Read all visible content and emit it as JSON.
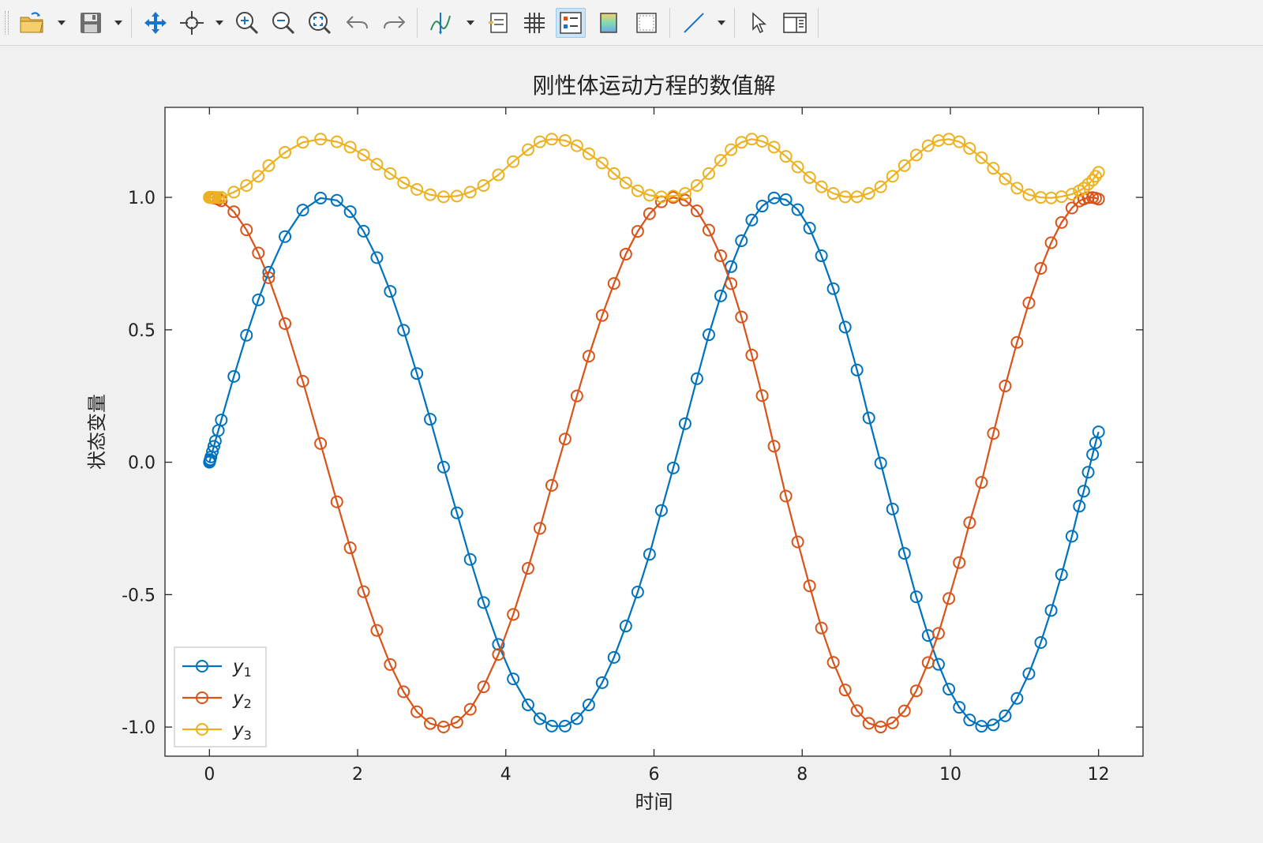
{
  "toolbar": {
    "buttons": [
      {
        "name": "open-file-icon",
        "dropdown": true
      },
      {
        "name": "save-icon",
        "dropdown": true
      },
      {
        "name": "pan-icon",
        "dropdown": false
      },
      {
        "name": "rotate-3d-icon",
        "dropdown": true
      },
      {
        "name": "zoom-in-icon",
        "dropdown": false
      },
      {
        "name": "zoom-out-icon",
        "dropdown": false
      },
      {
        "name": "zoom-fit-icon",
        "dropdown": false
      },
      {
        "name": "undo-icon",
        "dropdown": false
      },
      {
        "name": "redo-icon",
        "dropdown": false
      },
      {
        "name": "data-cursor-icon",
        "dropdown": true
      },
      {
        "name": "insert-legend-icon",
        "dropdown": false
      },
      {
        "name": "grid-icon",
        "dropdown": false
      },
      {
        "name": "legend-toggle-icon",
        "dropdown": false,
        "active": true
      },
      {
        "name": "colorbar-icon",
        "dropdown": false
      },
      {
        "name": "axes-box-icon",
        "dropdown": false
      },
      {
        "name": "insert-line-icon",
        "dropdown": true
      },
      {
        "name": "select-pointer-icon",
        "dropdown": false
      },
      {
        "name": "property-editor-icon",
        "dropdown": false
      }
    ],
    "accent": "#1a73c9"
  },
  "chart_data": {
    "type": "line",
    "title": "刚性体运动方程的数值解",
    "xlabel": "时间",
    "ylabel": "状态变量",
    "xlim": [
      -0.6,
      12.6
    ],
    "ylim": [
      -1.11,
      1.34
    ],
    "xticks": [
      0,
      2,
      4,
      6,
      8,
      10,
      12
    ],
    "xtick_labels": [
      "0",
      "2",
      "4",
      "6",
      "8",
      "10",
      "12"
    ],
    "yticks": [
      -1.0,
      -0.5,
      0.0,
      0.5,
      1.0
    ],
    "ytick_labels": [
      "-1.0",
      "-0.5",
      "0.0",
      "0.5",
      "1.0"
    ],
    "grid": false,
    "legend_position": "bottom-left",
    "marker": "circle",
    "x": [
      0,
      0.005,
      0.01,
      0.02,
      0.04,
      0.06,
      0.08,
      0.12,
      0.16,
      0.33,
      0.5,
      0.66,
      0.8,
      1.02,
      1.26,
      1.5,
      1.72,
      1.9,
      2.08,
      2.26,
      2.44,
      2.62,
      2.8,
      2.98,
      3.16,
      3.34,
      3.52,
      3.7,
      3.9,
      4.1,
      4.3,
      4.46,
      4.62,
      4.8,
      4.96,
      5.12,
      5.3,
      5.46,
      5.62,
      5.78,
      5.94,
      6.1,
      6.26,
      6.42,
      6.58,
      6.74,
      6.9,
      7.04,
      7.18,
      7.32,
      7.46,
      7.62,
      7.78,
      7.94,
      8.1,
      8.26,
      8.42,
      8.58,
      8.74,
      8.9,
      9.06,
      9.22,
      9.38,
      9.54,
      9.7,
      9.84,
      9.98,
      10.12,
      10.26,
      10.42,
      10.58,
      10.74,
      10.9,
      11.06,
      11.22,
      11.36,
      11.5,
      11.64,
      11.74,
      11.8,
      11.86,
      11.92,
      11.96,
      12.0
    ],
    "series": [
      {
        "name": "y",
        "sub": "1",
        "color": "#0072bd",
        "values": [
          0,
          0.005,
          0.01,
          0.02,
          0.04,
          0.06,
          0.08,
          0.1198,
          0.1593,
          0.3241,
          0.4794,
          0.6131,
          0.7174,
          0.8521,
          0.9521,
          0.9975,
          0.9889,
          0.9463,
          0.8724,
          0.7725,
          0.6453,
          0.4984,
          0.335,
          0.1622,
          -0.0184,
          -0.1912,
          -0.3671,
          -0.5298,
          -0.6878,
          -0.8182,
          -0.9162,
          -0.9683,
          -0.9962,
          -0.9962,
          -0.9682,
          -0.9164,
          -0.8323,
          -0.7369,
          -0.6187,
          -0.4901,
          -0.3477,
          -0.1822,
          -0.0216,
          0.1456,
          0.3155,
          0.4815,
          0.6282,
          0.7385,
          0.8362,
          0.9146,
          0.9673,
          0.9981,
          0.9915,
          0.9537,
          0.8839,
          0.7795,
          0.6554,
          0.5102,
          0.3481,
          0.1673,
          -0.0032,
          -0.1767,
          -0.3442,
          -0.5082,
          -0.6543,
          -0.7633,
          -0.8571,
          -0.9255,
          -0.9734,
          -0.9971,
          -0.9917,
          -0.9575,
          -0.8916,
          -0.7985,
          -0.6809,
          -0.5596,
          -0.4245,
          -0.2796,
          -0.1661,
          -0.1094,
          -0.0377,
          0.0294,
          0.0733,
          0.1146
        ]
      },
      {
        "name": "y",
        "sub": "2",
        "color": "#d95319",
        "values": [
          1.0,
          1.0,
          1.0,
          0.9998,
          0.9992,
          0.9982,
          0.9968,
          0.9928,
          0.9872,
          0.946,
          0.8776,
          0.79,
          0.6967,
          0.5234,
          0.3058,
          0.0707,
          -0.1494,
          -0.3233,
          -0.4889,
          -0.6351,
          -0.7638,
          -0.8668,
          -0.9422,
          -0.9868,
          -0.9998,
          -0.9816,
          -0.933,
          -0.848,
          -0.7259,
          -0.5748,
          -0.4008,
          -0.2497,
          -0.0873,
          0.0875,
          0.2502,
          0.4004,
          0.5541,
          0.6749,
          0.7858,
          0.8718,
          0.9383,
          0.9834,
          0.9998,
          0.9894,
          0.9491,
          0.8765,
          0.7797,
          0.6743,
          0.5484,
          0.4045,
          0.2515,
          0.0606,
          -0.1279,
          -0.3007,
          -0.4668,
          -0.6262,
          -0.7558,
          -0.8601,
          -0.9381,
          -0.9858,
          -0.9999,
          -0.9842,
          -0.9389,
          -0.8632,
          -0.7566,
          -0.6462,
          -0.5146,
          -0.3789,
          -0.2283,
          -0.0761,
          0.1087,
          0.288,
          0.4525,
          0.6016,
          0.7321,
          0.8288,
          0.9052,
          0.9601,
          0.9861,
          0.9941,
          0.9993,
          0.9996,
          0.9974,
          0.9934
        ]
      },
      {
        "name": "y",
        "sub": "3",
        "color": "#edb120",
        "values": [
          1.0,
          1.0,
          1.0,
          1.0,
          1.0,
          1.0,
          1.0,
          1.0,
          1.0,
          1.02,
          1.045,
          1.08,
          1.12,
          1.17,
          1.208,
          1.22,
          1.21,
          1.19,
          1.16,
          1.125,
          1.09,
          1.055,
          1.03,
          1.01,
          1.002,
          1.005,
          1.02,
          1.045,
          1.085,
          1.135,
          1.18,
          1.21,
          1.22,
          1.215,
          1.195,
          1.165,
          1.13,
          1.09,
          1.055,
          1.025,
          1.008,
          1.002,
          1.005,
          1.015,
          1.045,
          1.09,
          1.14,
          1.18,
          1.208,
          1.22,
          1.212,
          1.19,
          1.155,
          1.115,
          1.075,
          1.04,
          1.015,
          1.002,
          1.002,
          1.015,
          1.04,
          1.08,
          1.12,
          1.16,
          1.195,
          1.215,
          1.22,
          1.21,
          1.185,
          1.15,
          1.11,
          1.07,
          1.035,
          1.01,
          1.0,
          0.998,
          1.003,
          1.012,
          1.025,
          1.035,
          1.05,
          1.065,
          1.08,
          1.095
        ]
      }
    ]
  }
}
